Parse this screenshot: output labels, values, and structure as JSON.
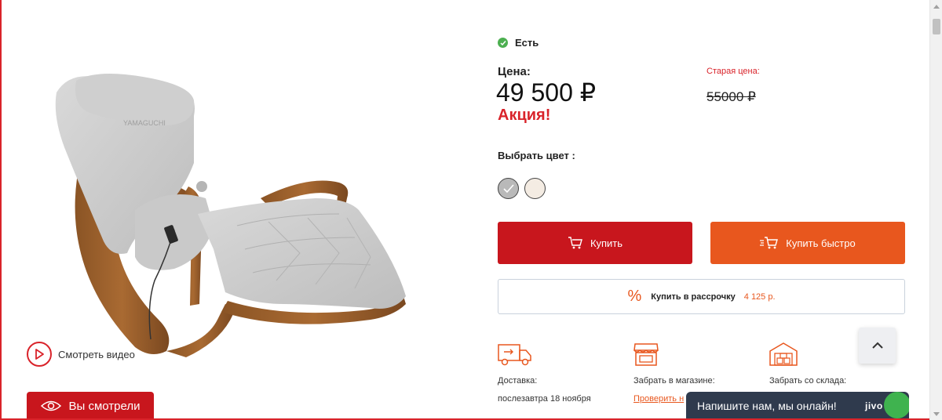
{
  "product": {
    "stock_status": "Есть",
    "price_label": "Цена:",
    "price": "49 500 ₽",
    "promo": "Акция!",
    "old_price_label": "Старая цена:",
    "old_price": "55000 ₽"
  },
  "color_picker": {
    "title": "Выбрать цвет :",
    "options": [
      {
        "color": "#b9b9b9",
        "selected": true
      },
      {
        "color": "#f4ece3",
        "selected": false
      }
    ]
  },
  "actions": {
    "buy_label": "Купить",
    "quick_buy_label": "Купить быстро",
    "installment_symbol": "%",
    "installment_label": "Купить в рассрочку",
    "installment_amount": "4 125 р."
  },
  "delivery": {
    "courier_title": "Доставка:",
    "courier_date": "послезавтра 18 ноября",
    "store_title": "Забрать в магазине:",
    "store_link": "Проверить н",
    "warehouse_title": "Забрать со склада:"
  },
  "media": {
    "watch_video_label": "Смотреть видео",
    "viewed_tab_label": "Вы смотрели",
    "chair_brand_text": "YAMAGUCHI"
  },
  "chat": {
    "message": "Напишите нам, мы онлайн!",
    "brand": "jivo"
  },
  "colors": {
    "accent_red": "#c8161d",
    "accent_orange": "#e8571e",
    "in_stock_green": "#4caf50",
    "chat_bg": "#2f3a4d"
  },
  "icons": [
    "check-icon",
    "cart-icon",
    "quick-cart-icon",
    "percent-icon",
    "truck-icon",
    "store-icon",
    "warehouse-icon",
    "play-icon",
    "eye-icon",
    "chevron-up-icon"
  ]
}
